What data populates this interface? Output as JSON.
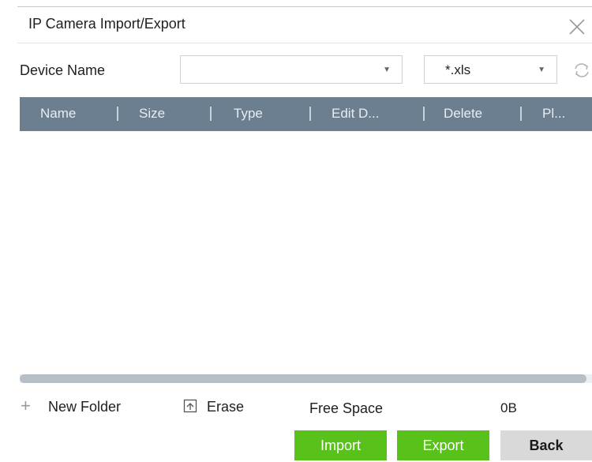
{
  "dialog": {
    "title": "IP Camera Import/Export",
    "close_icon": "close-icon"
  },
  "filters": {
    "device_label": "Device Name",
    "device_value": "",
    "extension_value": "*.xls",
    "refresh_icon": "refresh-icon"
  },
  "table": {
    "columns": [
      "Name",
      "Size",
      "Type",
      "Edit D...",
      "Delete",
      "Pl..."
    ],
    "rows": []
  },
  "toolbar": {
    "new_folder_label": "New Folder",
    "new_folder_icon": "plus-icon",
    "erase_label": "Erase",
    "erase_icon": "erase-icon",
    "free_space_label": "Free Space",
    "free_space_value": "0B"
  },
  "buttons": {
    "import_label": "Import",
    "export_label": "Export",
    "back_label": "Back"
  },
  "colors": {
    "header_bg": "#6b7f91",
    "primary_button": "#59c21a",
    "secondary_button": "#d9d9d9"
  }
}
